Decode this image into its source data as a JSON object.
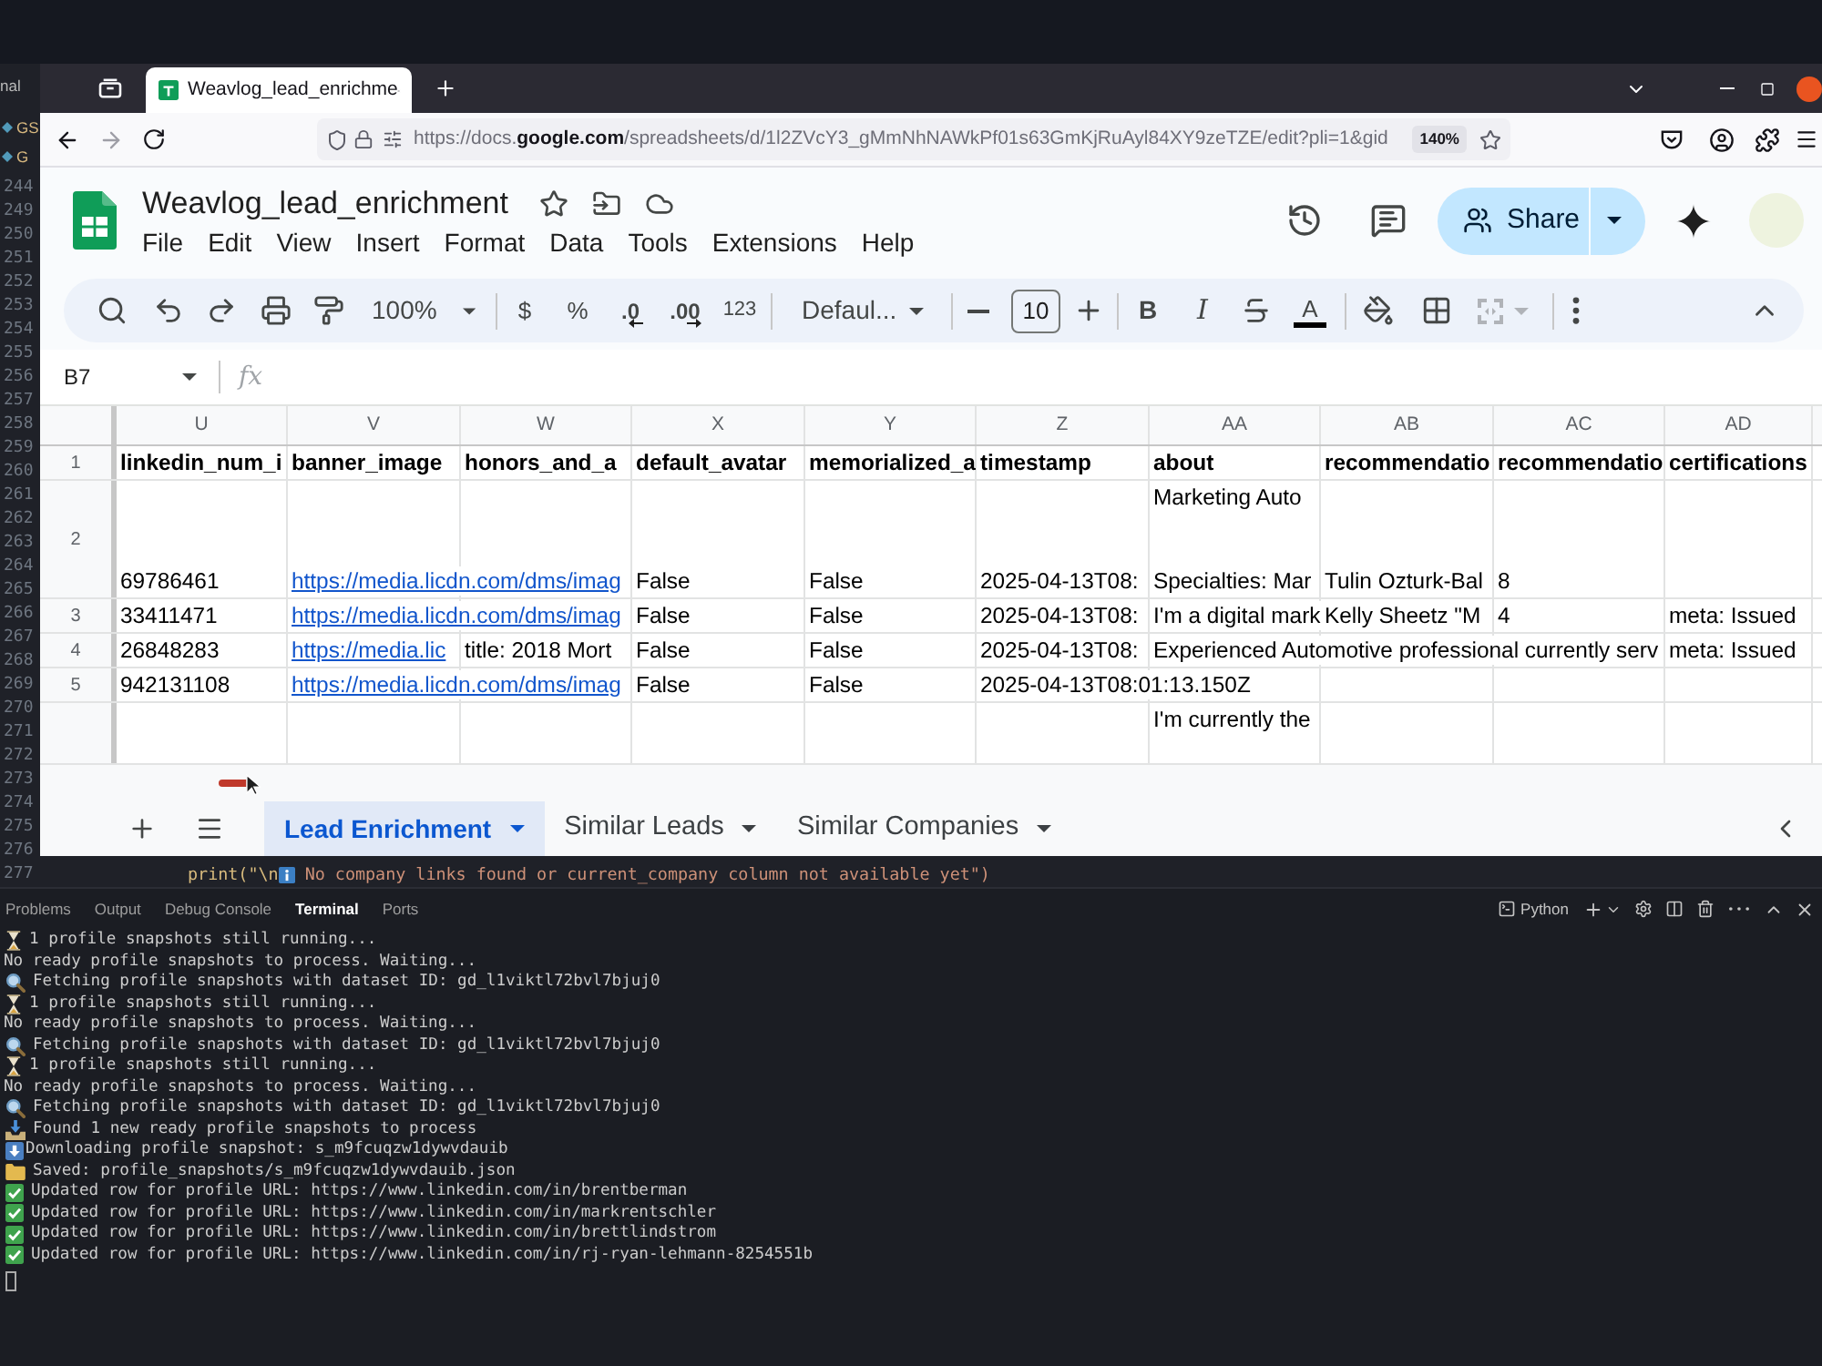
{
  "editor": {
    "fragments": [
      {
        "text": "nal",
        "has_icon": false
      },
      {
        "text": "GS",
        "has_icon": true
      },
      {
        "text": "G",
        "has_icon": true
      }
    ],
    "line_numbers": [
      "244",
      "249",
      "250",
      "251",
      "252",
      "253",
      "254",
      "255",
      "256",
      "257",
      "258",
      "259",
      "260",
      "261",
      "262",
      "263",
      "264",
      "265",
      "266",
      "267",
      "268",
      "269",
      "270",
      "271",
      "272",
      "273",
      "274",
      "275",
      "276",
      "277"
    ],
    "code_line": {
      "before": "print(\"\\n",
      "after": " No company links found or current_company column not available yet\")"
    }
  },
  "browser": {
    "tabs": [
      {
        "title": "Weavlog_lead_enrichme",
        "selected": true
      }
    ],
    "url": "https://docs.**google.com**/spreadsheets/d/1l2ZVcY3_gMmNhNAWkPf01s63GmKjRuAyl84XY9zeTZE/edit?pli=1&gid",
    "zoom": "140%"
  },
  "sheet_doc": {
    "title": "Weavlog_lead_enrichment",
    "menu": [
      "File",
      "Edit",
      "View",
      "Insert",
      "Format",
      "Data",
      "Tools",
      "Extensions",
      "Help"
    ],
    "share_label": "Share"
  },
  "toolbar": {
    "zoom": "100%",
    "currency": "$",
    "percent": "%",
    "decrease_decimals": ".0",
    "increase_decimals": ".00",
    "number_format": "123",
    "font": "Defaul...",
    "font_size": "10",
    "bold": "B",
    "italic": "I",
    "text_color": "A"
  },
  "formula_bar": {
    "cell": "B7",
    "label": "fx"
  },
  "grid": {
    "columns": [
      "U",
      "V",
      "W",
      "X",
      "Y",
      "Z",
      "AA",
      "AB",
      "AC",
      "AD"
    ],
    "rows": [
      {
        "number": "1",
        "kind": "header",
        "cells": [
          {
            "text": "linkedin_num_i"
          },
          {
            "text": "banner_image"
          },
          {
            "text": "honors_and_a"
          },
          {
            "text": "default_avatar"
          },
          {
            "text": "memorialized_a"
          },
          {
            "text": "timestamp"
          },
          {
            "text": "about"
          },
          {
            "text": "recommendatio"
          },
          {
            "text": "recommendatio"
          },
          {
            "text": "certifications"
          }
        ]
      },
      {
        "number": "2",
        "kind": "data",
        "cells": [
          {
            "text": "69786461"
          },
          {
            "text": "https://media.licdn.com/dms/imag",
            "kind": "link"
          },
          null,
          {
            "text": "False"
          },
          {
            "text": "False"
          },
          {
            "text": "2025-04-13T08:"
          },
          {
            "lines": [
              "Marketing Auto",
              "Specialties: Mar"
            ]
          },
          {
            "text": "Tulin Ozturk-Bal"
          },
          {
            "text": "8"
          },
          null
        ]
      },
      {
        "number": "3",
        "kind": "data",
        "cells": [
          {
            "text": "33411471"
          },
          {
            "text": "https://media.licdn.com/dms/imag",
            "kind": "link"
          },
          null,
          {
            "text": "False"
          },
          {
            "text": "False"
          },
          {
            "text": "2025-04-13T08:"
          },
          {
            "text": "I'm a digital mark"
          },
          {
            "text": "Kelly Sheetz \"M"
          },
          {
            "text": "4"
          },
          {
            "text": "meta: Issued"
          }
        ]
      },
      {
        "number": "4",
        "kind": "data",
        "cells": [
          {
            "text": "26848283"
          },
          {
            "text": "https://media.lic",
            "kind": "link"
          },
          {
            "text": "title: 2018 Mort"
          },
          {
            "text": "False"
          },
          {
            "text": "False"
          },
          {
            "text": "2025-04-13T08:"
          },
          {
            "text": "Experienced Automotive professional currently serv"
          },
          null,
          null,
          {
            "text": "meta: Issued"
          }
        ]
      },
      {
        "number": "5",
        "kind": "data",
        "cells": [
          {
            "text": "942131108"
          },
          {
            "text": "https://media.licdn.com/dms/imag",
            "kind": "link"
          },
          null,
          {
            "text": "False"
          },
          {
            "text": "False"
          },
          {
            "text": "2025-04-13T08:01:13.150Z"
          },
          null,
          null,
          null,
          null
        ]
      },
      {
        "kind": "data",
        "cells": [
          null,
          null,
          null,
          null,
          null,
          null,
          {
            "lines": [
              "I'm currently the"
            ]
          },
          null,
          null,
          null
        ]
      }
    ]
  },
  "sheet_tabs": [
    {
      "label": "Lead Enrichment",
      "selected": true
    },
    {
      "label": "Similar Leads",
      "selected": false
    },
    {
      "label": "Similar Companies",
      "selected": false
    }
  ],
  "panel": {
    "tabs": [
      {
        "label": "Problems",
        "selected": false
      },
      {
        "label": "Output",
        "selected": false
      },
      {
        "label": "Debug Console",
        "selected": false
      },
      {
        "label": "Terminal",
        "selected": true
      },
      {
        "label": "Ports",
        "selected": false
      }
    ],
    "shell": "Python"
  },
  "terminal": {
    "lines": [
      {
        "kind": "hourglass",
        "text": "1 profile snapshots still running..."
      },
      {
        "kind": "plain",
        "text": "No ready profile snapshots to process. Waiting..."
      },
      {
        "kind": "search",
        "text": "Fetching profile snapshots with dataset ID: gd_l1viktl72bvl7bjuj0"
      },
      {
        "kind": "hourglass",
        "text": "1 profile snapshots still running..."
      },
      {
        "kind": "plain",
        "text": "No ready profile snapshots to process. Waiting..."
      },
      {
        "kind": "search",
        "text": "Fetching profile snapshots with dataset ID: gd_l1viktl72bvl7bjuj0"
      },
      {
        "kind": "hourglass",
        "text": "1 profile snapshots still running..."
      },
      {
        "kind": "plain",
        "text": "No ready profile snapshots to process. Waiting..."
      },
      {
        "kind": "search",
        "text": "Fetching profile snapshots with dataset ID: gd_l1viktl72bvl7bjuj0"
      },
      {
        "kind": "tray",
        "text": "Found 1 new ready profile snapshots to process"
      },
      {
        "kind": "download",
        "text": "Downloading profile snapshot: s_m9fcuqzw1dywvdauib"
      },
      {
        "kind": "folder",
        "text": "Saved: profile_snapshots/s_m9fcuqzw1dywvdauib.json"
      },
      {
        "kind": "check",
        "text": "Updated row for profile URL: https://www.linkedin.com/in/brentberman"
      },
      {
        "kind": "check",
        "text": "Updated row for profile URL: https://www.linkedin.com/in/markrentschler"
      },
      {
        "kind": "check",
        "text": "Updated row for profile URL: https://www.linkedin.com/in/brettlindstrom"
      },
      {
        "kind": "check",
        "text": "Updated row for profile URL: https://www.linkedin.com/in/rj-ryan-lehmann-8254551b"
      }
    ]
  }
}
